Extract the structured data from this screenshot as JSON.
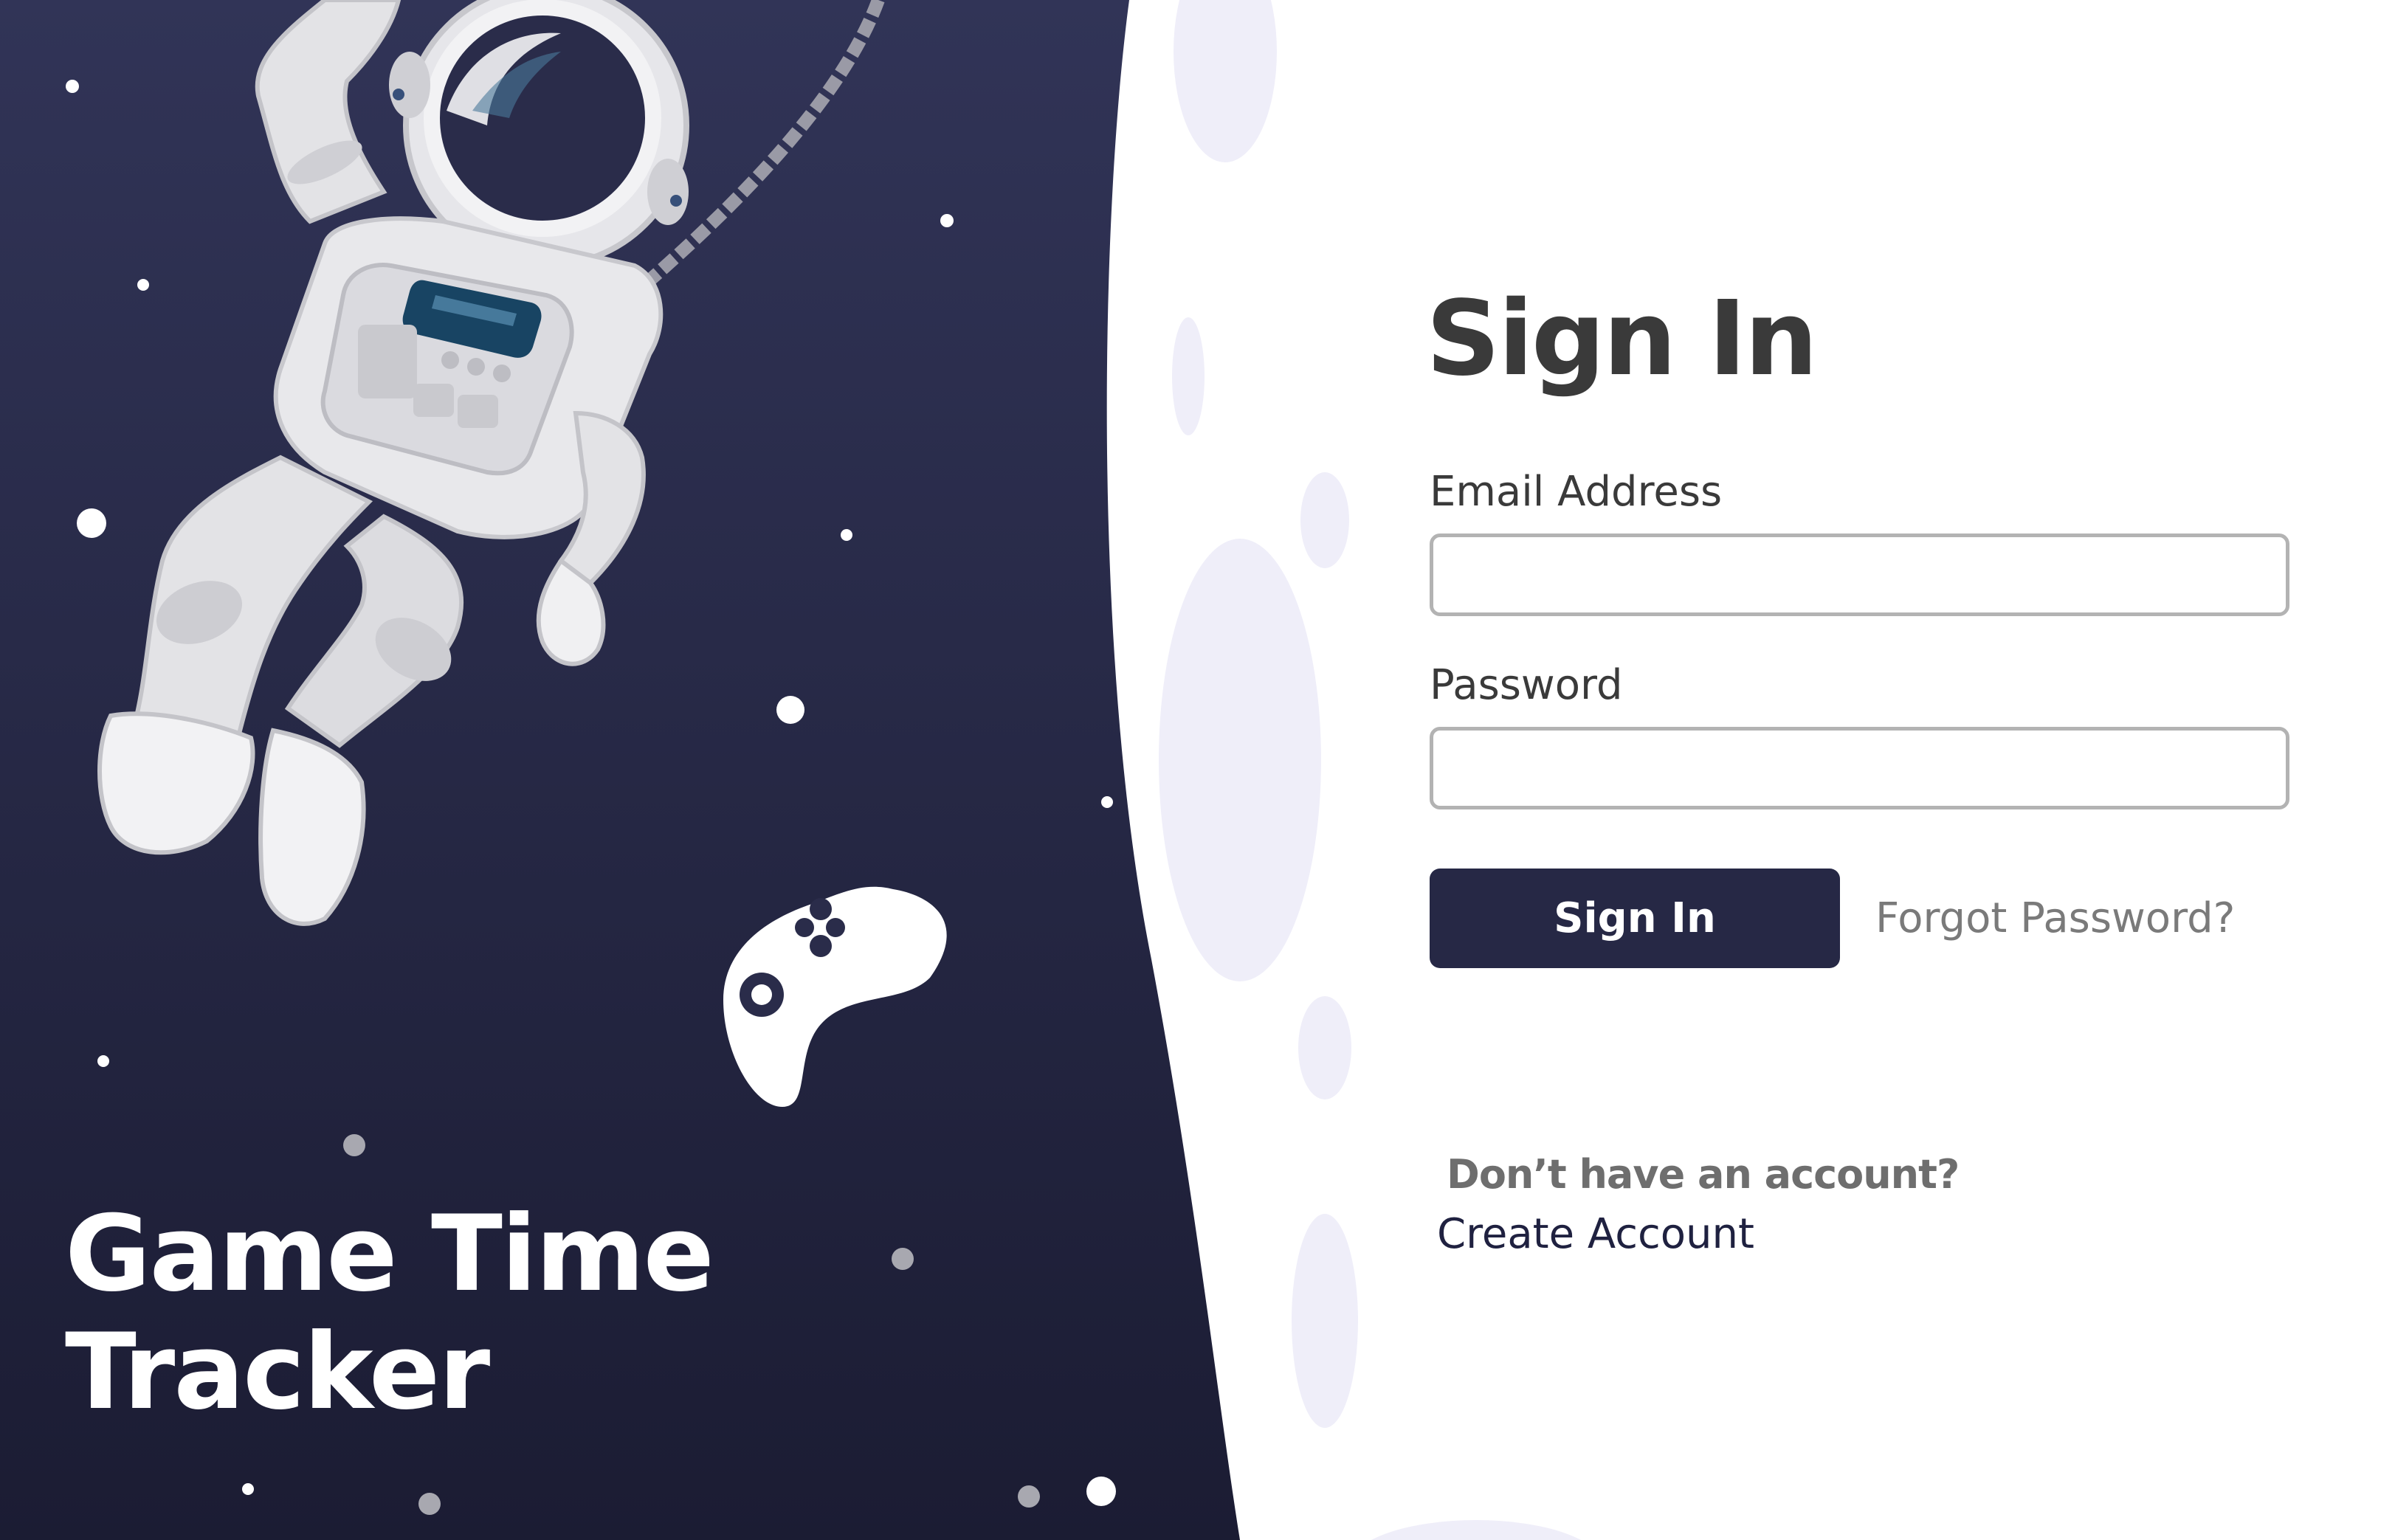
{
  "branding": {
    "app_title_line1": "Game Time",
    "app_title_line2": "Tracker"
  },
  "signin": {
    "title": "Sign In",
    "email_label": "Email Address",
    "email_value": "",
    "password_label": "Password",
    "password_value": "",
    "submit_label": "Sign In",
    "forgot_label": "Forgot Password?",
    "no_account_text": "Don’t have an account?",
    "create_account_label": "Create Account"
  },
  "colors": {
    "panel_dark": "#1c1d35",
    "panel_light": "#303357",
    "button_bg": "#262845",
    "crater": "#efeef9"
  },
  "icons": {
    "astronaut": "astronaut-illustration",
    "gamepad": "gamepad-icon",
    "stars": "star-dots"
  }
}
